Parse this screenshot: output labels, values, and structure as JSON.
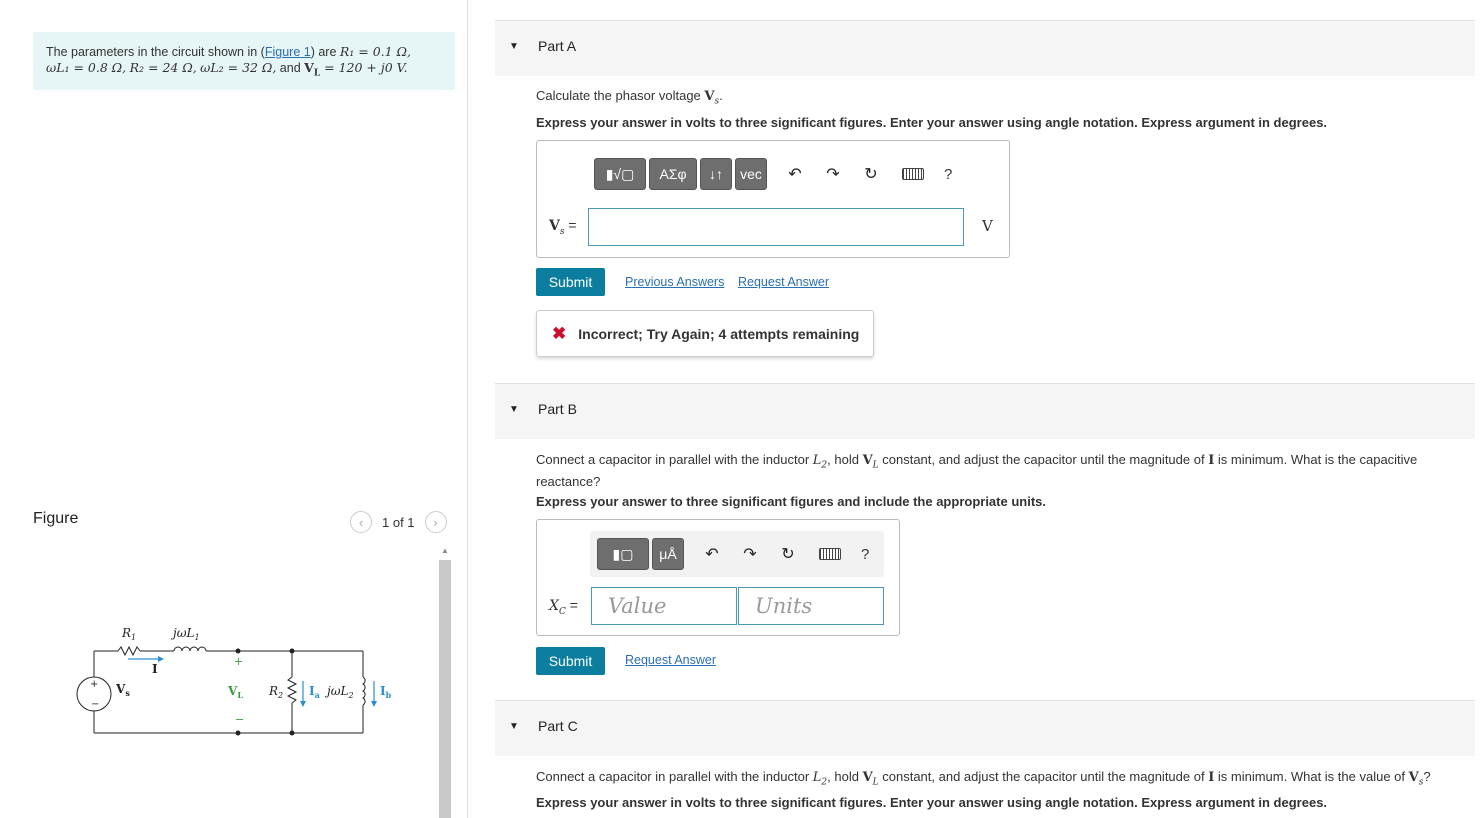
{
  "problem": {
    "text_pre": "The parameters in the circuit shown in (",
    "figure_link": "Figure 1",
    "text_post_link": ") are ",
    "r1": "R₁ = 0.1 Ω,",
    "wl1": "ωL₁ = 0.8 Ω,",
    "r2": "R₂ = 24 Ω,",
    "wl2": "ωL₂ = 32 Ω,",
    "and": "and",
    "vl": "V",
    "vl_sub": "L",
    "vl_val": " = 120 + j0 V."
  },
  "figure": {
    "label": "Figure",
    "pager": "1 of 1",
    "prev_icon": "chevron-left-icon",
    "next_icon": "chevron-right-icon",
    "labels": {
      "r1": "R",
      "r1_sub": "1",
      "jwl1": "jωL",
      "jwl1_sub": "1",
      "current": "I",
      "vs": "V",
      "vs_sub": "s",
      "vl": "V",
      "vl_sub": "L",
      "r2": "R",
      "r2_sub": "2",
      "ia": "I",
      "ia_sub": "a",
      "jwl2": "jωL",
      "jwl2_sub": "2",
      "ib": "I",
      "ib_sub": "b",
      "plus": "+",
      "minus": "−"
    }
  },
  "part_a": {
    "title": "Part A",
    "question_pre": "Calculate the phasor voltage ",
    "question_var": "V",
    "question_sub": "s",
    "question_post": ".",
    "instructions": "Express your answer in volts to three significant figures. Enter your answer using angle notation. Express argument in degrees.",
    "toolbar": {
      "templates_label": "▮√▢",
      "greek_label": "ΑΣφ",
      "sort_label": "↓↑",
      "vec_label": "vec",
      "undo_icon": "undo-icon",
      "redo_icon": "redo-icon",
      "reset_icon": "reset-icon",
      "keyboard_icon": "keyboard-icon",
      "help_label": "?"
    },
    "field_label": "V",
    "field_sub": "s",
    "field_eq": " =",
    "field_value": "",
    "unit": "V",
    "submit_label": "Submit",
    "prev_answers_label": "Previous Answers",
    "request_answer_label": "Request Answer",
    "feedback": "Incorrect; Try Again; 4 attempts remaining",
    "feedback_icon": "x-icon"
  },
  "part_b": {
    "title": "Part B",
    "question_pre": "Connect a capacitor in parallel with the inductor ",
    "l2": "L",
    "l2_sub": "2",
    "question_mid": ", hold ",
    "vl": "V",
    "vl_sub": "L",
    "question_mid2": " constant, and adjust the capacitor until the magnitude of ",
    "i": "I",
    "question_post": " is minimum. What is the capacitive reactance?",
    "instructions": "Express your answer to three significant figures and include the appropriate units.",
    "toolbar": {
      "templates_label": "▮▢",
      "units_label": "μÅ",
      "help_label": "?"
    },
    "field_label": "X",
    "field_sub": "C",
    "field_eq": " =",
    "value_placeholder": "Value",
    "units_placeholder": "Units",
    "submit_label": "Submit",
    "request_answer_label": "Request Answer"
  },
  "part_c": {
    "title": "Part C",
    "question_pre": "Connect a capacitor in parallel with the inductor ",
    "l2": "L",
    "l2_sub": "2",
    "question_mid": ", hold ",
    "vl": "V",
    "vl_sub": "L",
    "question_mid2": " constant, and adjust the capacitor until the magnitude of ",
    "i": "I",
    "question_post": " is minimum. What is the value of ",
    "vs": "V",
    "vs_sub": "s",
    "question_end": "?",
    "instructions": "Express your answer in volts to three significant figures. Enter your answer using angle notation. Express argument in degrees."
  }
}
